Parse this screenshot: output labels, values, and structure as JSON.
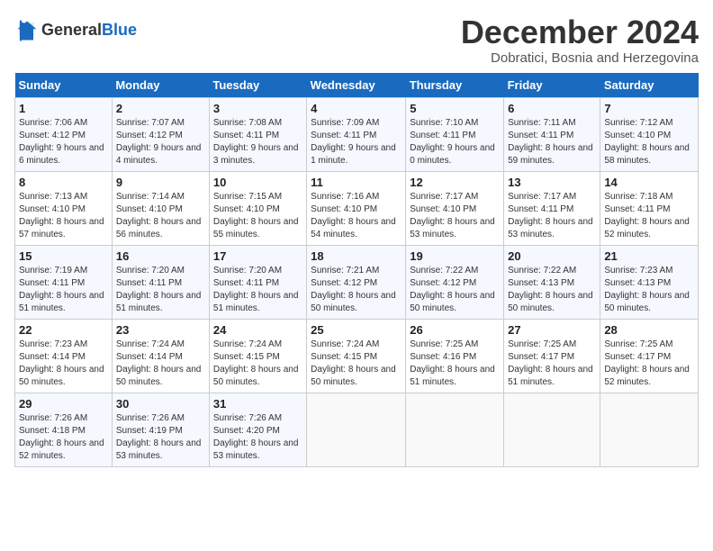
{
  "header": {
    "logo_line1": "General",
    "logo_line2": "Blue",
    "month_title": "December 2024",
    "subtitle": "Dobratici, Bosnia and Herzegovina"
  },
  "weekdays": [
    "Sunday",
    "Monday",
    "Tuesday",
    "Wednesday",
    "Thursday",
    "Friday",
    "Saturday"
  ],
  "weeks": [
    [
      {
        "day": "1",
        "sunrise": "7:06 AM",
        "sunset": "4:12 PM",
        "daylight": "9 hours and 6 minutes."
      },
      {
        "day": "2",
        "sunrise": "7:07 AM",
        "sunset": "4:12 PM",
        "daylight": "9 hours and 4 minutes."
      },
      {
        "day": "3",
        "sunrise": "7:08 AM",
        "sunset": "4:11 PM",
        "daylight": "9 hours and 3 minutes."
      },
      {
        "day": "4",
        "sunrise": "7:09 AM",
        "sunset": "4:11 PM",
        "daylight": "9 hours and 1 minute."
      },
      {
        "day": "5",
        "sunrise": "7:10 AM",
        "sunset": "4:11 PM",
        "daylight": "9 hours and 0 minutes."
      },
      {
        "day": "6",
        "sunrise": "7:11 AM",
        "sunset": "4:11 PM",
        "daylight": "8 hours and 59 minutes."
      },
      {
        "day": "7",
        "sunrise": "7:12 AM",
        "sunset": "4:10 PM",
        "daylight": "8 hours and 58 minutes."
      }
    ],
    [
      {
        "day": "8",
        "sunrise": "7:13 AM",
        "sunset": "4:10 PM",
        "daylight": "8 hours and 57 minutes."
      },
      {
        "day": "9",
        "sunrise": "7:14 AM",
        "sunset": "4:10 PM",
        "daylight": "8 hours and 56 minutes."
      },
      {
        "day": "10",
        "sunrise": "7:15 AM",
        "sunset": "4:10 PM",
        "daylight": "8 hours and 55 minutes."
      },
      {
        "day": "11",
        "sunrise": "7:16 AM",
        "sunset": "4:10 PM",
        "daylight": "8 hours and 54 minutes."
      },
      {
        "day": "12",
        "sunrise": "7:17 AM",
        "sunset": "4:10 PM",
        "daylight": "8 hours and 53 minutes."
      },
      {
        "day": "13",
        "sunrise": "7:17 AM",
        "sunset": "4:11 PM",
        "daylight": "8 hours and 53 minutes."
      },
      {
        "day": "14",
        "sunrise": "7:18 AM",
        "sunset": "4:11 PM",
        "daylight": "8 hours and 52 minutes."
      }
    ],
    [
      {
        "day": "15",
        "sunrise": "7:19 AM",
        "sunset": "4:11 PM",
        "daylight": "8 hours and 51 minutes."
      },
      {
        "day": "16",
        "sunrise": "7:20 AM",
        "sunset": "4:11 PM",
        "daylight": "8 hours and 51 minutes."
      },
      {
        "day": "17",
        "sunrise": "7:20 AM",
        "sunset": "4:11 PM",
        "daylight": "8 hours and 51 minutes."
      },
      {
        "day": "18",
        "sunrise": "7:21 AM",
        "sunset": "4:12 PM",
        "daylight": "8 hours and 50 minutes."
      },
      {
        "day": "19",
        "sunrise": "7:22 AM",
        "sunset": "4:12 PM",
        "daylight": "8 hours and 50 minutes."
      },
      {
        "day": "20",
        "sunrise": "7:22 AM",
        "sunset": "4:13 PM",
        "daylight": "8 hours and 50 minutes."
      },
      {
        "day": "21",
        "sunrise": "7:23 AM",
        "sunset": "4:13 PM",
        "daylight": "8 hours and 50 minutes."
      }
    ],
    [
      {
        "day": "22",
        "sunrise": "7:23 AM",
        "sunset": "4:14 PM",
        "daylight": "8 hours and 50 minutes."
      },
      {
        "day": "23",
        "sunrise": "7:24 AM",
        "sunset": "4:14 PM",
        "daylight": "8 hours and 50 minutes."
      },
      {
        "day": "24",
        "sunrise": "7:24 AM",
        "sunset": "4:15 PM",
        "daylight": "8 hours and 50 minutes."
      },
      {
        "day": "25",
        "sunrise": "7:24 AM",
        "sunset": "4:15 PM",
        "daylight": "8 hours and 50 minutes."
      },
      {
        "day": "26",
        "sunrise": "7:25 AM",
        "sunset": "4:16 PM",
        "daylight": "8 hours and 51 minutes."
      },
      {
        "day": "27",
        "sunrise": "7:25 AM",
        "sunset": "4:17 PM",
        "daylight": "8 hours and 51 minutes."
      },
      {
        "day": "28",
        "sunrise": "7:25 AM",
        "sunset": "4:17 PM",
        "daylight": "8 hours and 52 minutes."
      }
    ],
    [
      {
        "day": "29",
        "sunrise": "7:26 AM",
        "sunset": "4:18 PM",
        "daylight": "8 hours and 52 minutes."
      },
      {
        "day": "30",
        "sunrise": "7:26 AM",
        "sunset": "4:19 PM",
        "daylight": "8 hours and 53 minutes."
      },
      {
        "day": "31",
        "sunrise": "7:26 AM",
        "sunset": "4:20 PM",
        "daylight": "8 hours and 53 minutes."
      },
      null,
      null,
      null,
      null
    ]
  ],
  "labels": {
    "sunrise": "Sunrise:",
    "sunset": "Sunset:",
    "daylight": "Daylight:"
  }
}
